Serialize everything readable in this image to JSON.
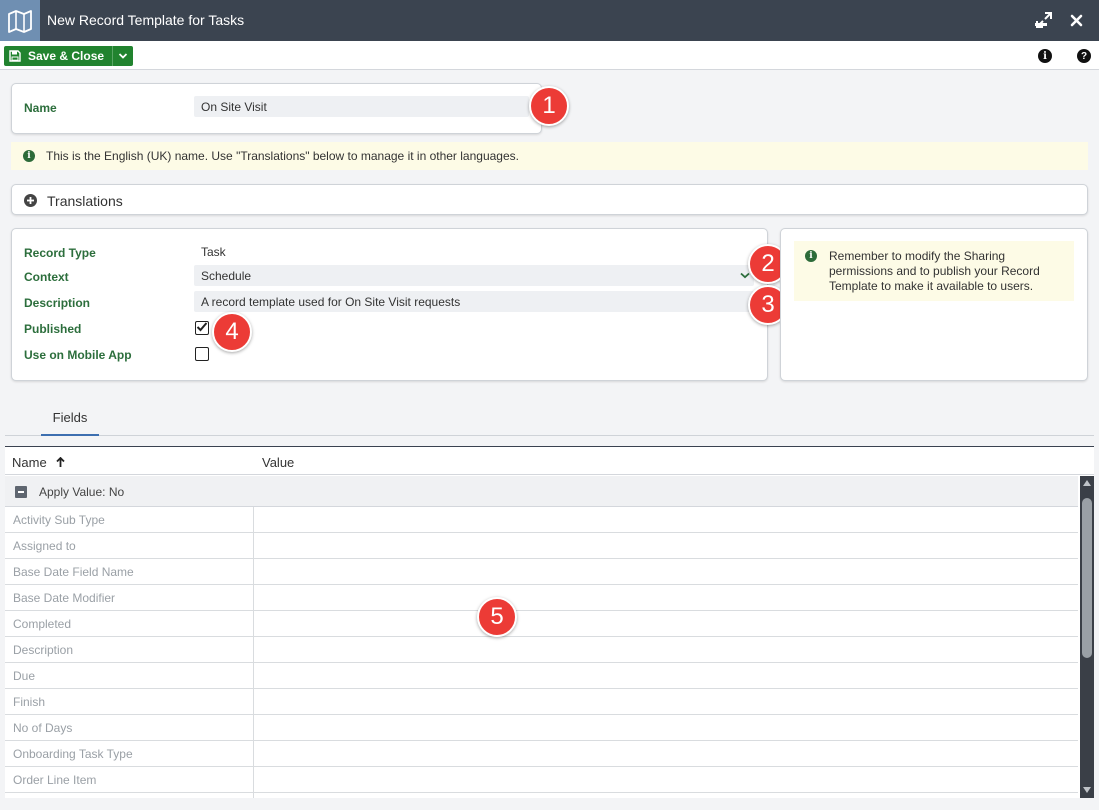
{
  "window": {
    "title": "New Record Template for Tasks",
    "icon": "map-icon",
    "controls": [
      "minimize-icon",
      "maximize-icon",
      "close-icon"
    ]
  },
  "toolbar": {
    "save_label": "Save & Close",
    "right_icons": [
      "info-icon",
      "help-icon"
    ]
  },
  "form": {
    "name_label": "Name",
    "name_value": "On Site Visit",
    "info_text": "This is the English (UK) name. Use \"Translations\" below to manage it in other languages.",
    "translations_label": "Translations",
    "record_type_label": "Record Type",
    "record_type_value": "Task",
    "context_label": "Context",
    "context_value": "Schedule",
    "description_label": "Description",
    "description_value": "A record template used for On Site Visit requests",
    "published_label": "Published",
    "published_checked": true,
    "mobile_label": "Use on Mobile App",
    "mobile_checked": false,
    "notice_line1": "Remember to modify the Sharing",
    "notice_line2": "permissions and to publish your Record",
    "notice_line3": "Template to make it available to users."
  },
  "tabs": [
    {
      "label": "Fields",
      "active": true
    }
  ],
  "grid": {
    "col_name": "Name",
    "col_value": "Value",
    "group_label": "Apply Value: No",
    "rows": [
      {
        "name": "Activity Sub Type"
      },
      {
        "name": "Assigned to"
      },
      {
        "name": "Base Date Field Name"
      },
      {
        "name": "Base Date Modifier"
      },
      {
        "name": "Completed"
      },
      {
        "name": "Description"
      },
      {
        "name": "Due"
      },
      {
        "name": "Finish"
      },
      {
        "name": "No of Days"
      },
      {
        "name": "Onboarding Task Type"
      },
      {
        "name": "Order Line Item"
      },
      {
        "name": ""
      }
    ]
  },
  "badges": [
    "1",
    "2",
    "3",
    "4",
    "5"
  ],
  "colors": {
    "titlebar": "#3b4450",
    "save_button": "#21832f",
    "label_green": "#2c6e3c",
    "badge_red": "#ec3b36",
    "info_bg": "#fdfbe6"
  }
}
